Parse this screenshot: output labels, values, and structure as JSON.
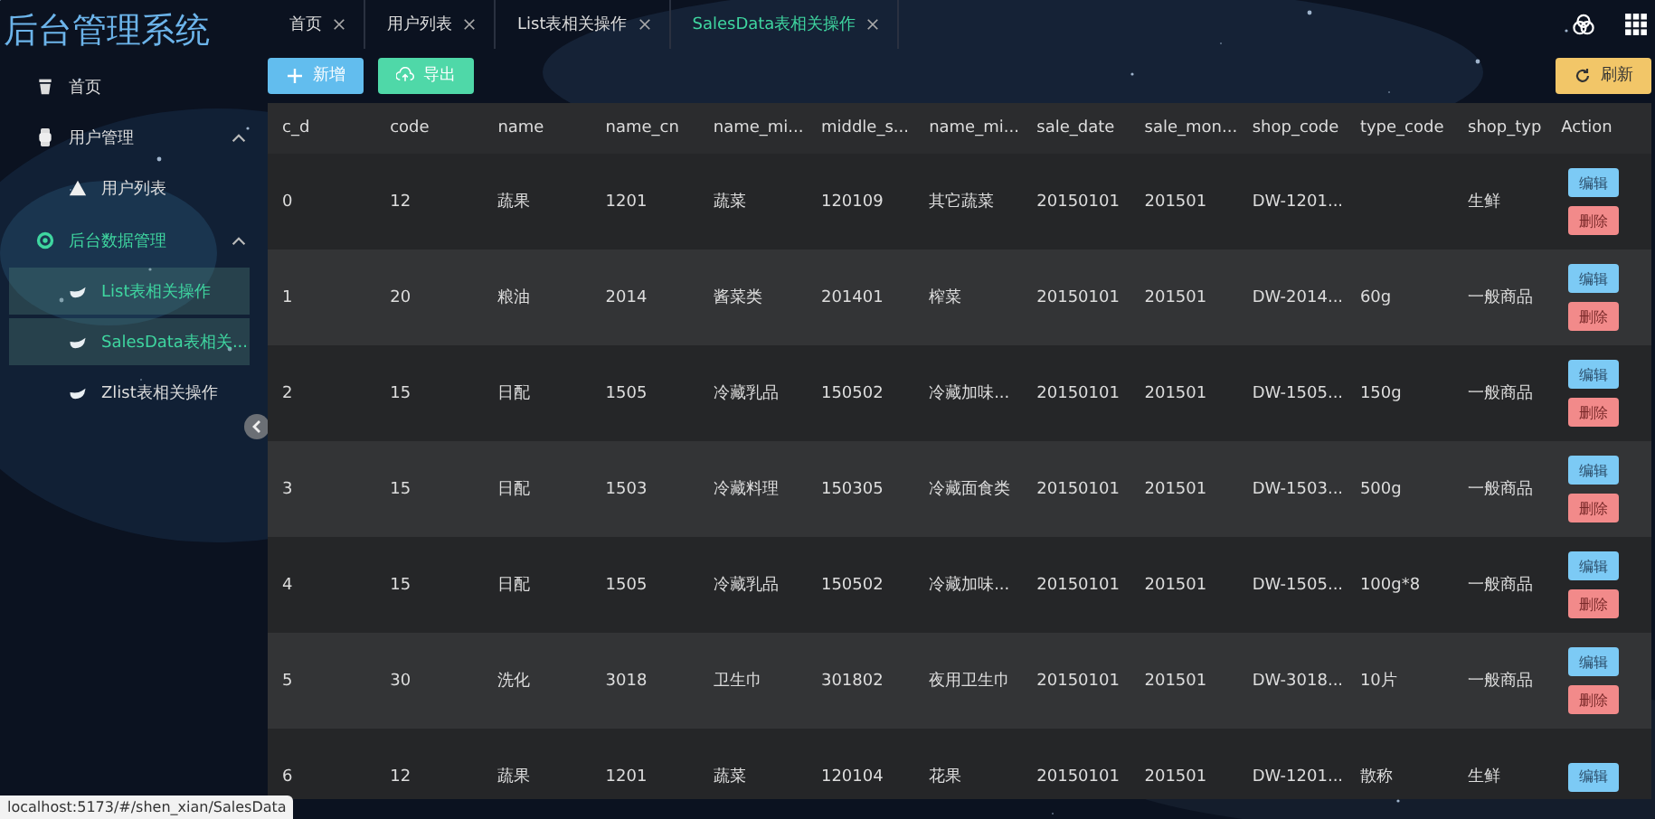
{
  "sidebar": {
    "title": "后台管理系统",
    "items": [
      {
        "label": "首页",
        "active": false
      },
      {
        "label": "用户管理",
        "active": false,
        "expanded": true,
        "children": [
          {
            "label": "用户列表",
            "highlighted": false
          }
        ]
      },
      {
        "label": "后台数据管理",
        "active": true,
        "expanded": true,
        "children": [
          {
            "label": "List表相关操作",
            "highlighted": true
          },
          {
            "label": "SalesData表相关...",
            "highlighted": true
          },
          {
            "label": "Zlist表相关操作",
            "highlighted": false
          }
        ]
      }
    ]
  },
  "tabs": [
    {
      "label": "首页",
      "selected": false
    },
    {
      "label": "用户列表",
      "selected": false
    },
    {
      "label": "List表相关操作",
      "selected": false
    },
    {
      "label": "SalesData表相关操作",
      "selected": true
    }
  ],
  "toolbar": {
    "add": "新增",
    "export": "导出",
    "refresh": "刷新"
  },
  "table": {
    "columns": [
      "c_d",
      "code",
      "name",
      "name_cn",
      "name_mi...",
      "middle_s...",
      "name_mi...",
      "sale_date",
      "sale_mon...",
      "shop_code",
      "type_code",
      "shop_typ",
      "Action"
    ],
    "rows": [
      {
        "cells": [
          "0",
          "12",
          "蔬果",
          "1201",
          "蔬菜",
          "120109",
          "其它蔬菜",
          "20150101",
          "201501",
          "DW-1201...",
          "",
          "生鲜"
        ],
        "actions": [
          "编辑",
          "删除"
        ]
      },
      {
        "cells": [
          "1",
          "20",
          "粮油",
          "2014",
          "酱菜类",
          "201401",
          "榨菜",
          "20150101",
          "201501",
          "DW-2014...",
          "60g",
          "一般商品"
        ],
        "actions": [
          "编辑",
          "删除"
        ]
      },
      {
        "cells": [
          "2",
          "15",
          "日配",
          "1505",
          "冷藏乳品",
          "150502",
          "冷藏加味...",
          "20150101",
          "201501",
          "DW-1505...",
          "150g",
          "一般商品"
        ],
        "actions": [
          "编辑",
          "删除"
        ]
      },
      {
        "cells": [
          "3",
          "15",
          "日配",
          "1503",
          "冷藏料理",
          "150305",
          "冷藏面食类",
          "20150101",
          "201501",
          "DW-1503...",
          "500g",
          "一般商品"
        ],
        "actions": [
          "编辑",
          "删除"
        ]
      },
      {
        "cells": [
          "4",
          "15",
          "日配",
          "1505",
          "冷藏乳品",
          "150502",
          "冷藏加味...",
          "20150101",
          "201501",
          "DW-1505...",
          "100g*8",
          "一般商品"
        ],
        "actions": [
          "编辑",
          "删除"
        ]
      },
      {
        "cells": [
          "5",
          "30",
          "洗化",
          "3018",
          "卫生巾",
          "301802",
          "夜用卫生巾",
          "20150101",
          "201501",
          "DW-3018...",
          "10片",
          "一般商品"
        ],
        "actions": [
          "编辑",
          "删除"
        ]
      },
      {
        "cells": [
          "6",
          "12",
          "蔬果",
          "1201",
          "蔬菜",
          "120104",
          "花果",
          "20150101",
          "201501",
          "DW-1201...",
          "散称",
          "生鲜"
        ],
        "actions": [
          "编辑"
        ]
      }
    ]
  },
  "status_url": "localhost:5173/#/shen_xian/SalesData"
}
